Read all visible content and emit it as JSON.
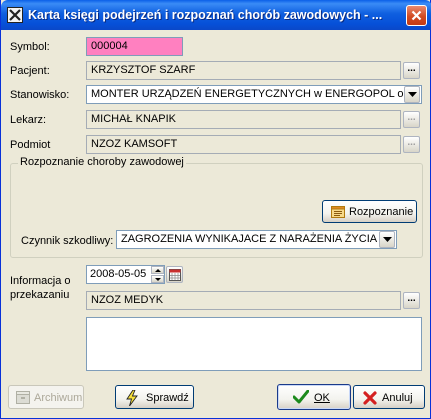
{
  "window": {
    "title": "Karta księgi podejrzeń i rozpoznań chorób zawodowych - ..."
  },
  "fields": {
    "symbol": {
      "label": "Symbol:",
      "value": "000004"
    },
    "pacjent": {
      "label": "Pacjent:",
      "value": "KRZYSZTOF SZARF"
    },
    "stanowisko": {
      "label": "Stanowisko:",
      "value": "MONTER URZĄDZEŃ ENERGETYCZNYCH w ENERGOPOL od"
    },
    "lekarz": {
      "label": "Lekarz:",
      "value": "MICHAŁ KNAPIK"
    },
    "podmiot": {
      "label": "Podmiot",
      "value": "NZOZ KAMSOFT"
    }
  },
  "rozpoznanie_group": {
    "caption": "Rozpoznanie choroby zawodowej",
    "button_label": "Rozpoznanie",
    "czynnik_label": "Czynnik szkodliwy:",
    "czynnik_value": "ZAGROZENIA WYNIKAJACE Z NARAŻENIA ŻYCIA"
  },
  "informacja": {
    "label_line1": "Informacja o",
    "label_line2": "przekazaniu",
    "date": "2008-05-05",
    "recipient": "NZOZ MEDYK",
    "note": ""
  },
  "buttons": {
    "archiwum": "Archiwum",
    "sprawdz": "Sprawdź",
    "ok": "OK",
    "anuluj": "Anuluj",
    "dots": "..."
  },
  "colors": {
    "symbol_field": "#FF80C0",
    "titlebar": "#0A5FE8",
    "face": "#ECE9D8"
  }
}
